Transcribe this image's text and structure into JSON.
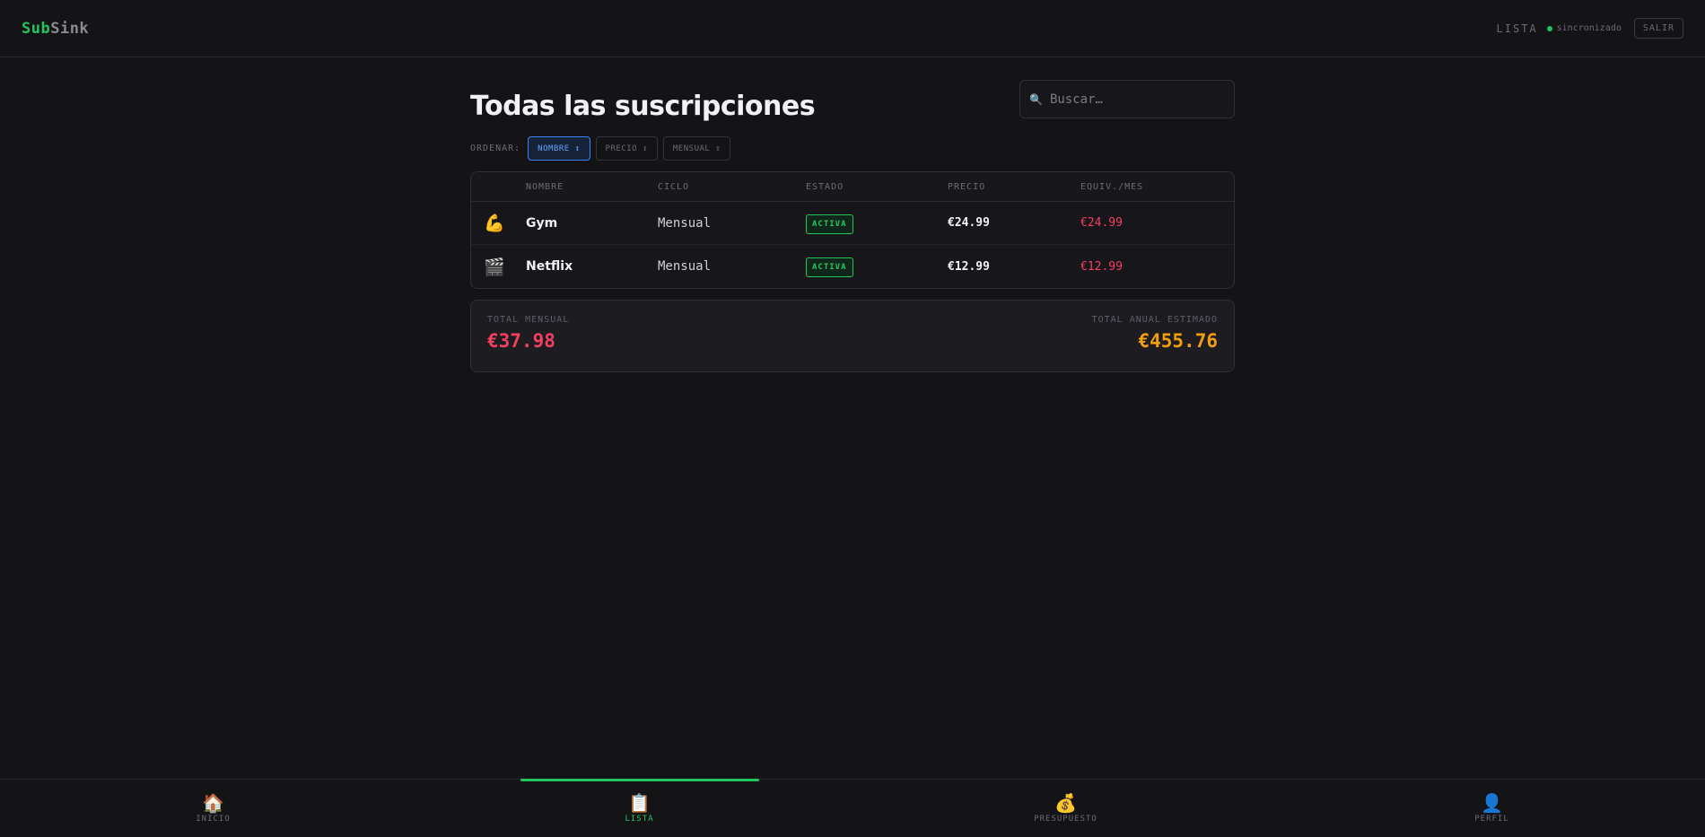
{
  "app": {
    "logo_part1": "Sub",
    "logo_part2": "Sink"
  },
  "header": {
    "view_label": "LISTA",
    "sync_status": "sincronizado",
    "logout_label": "SALIR"
  },
  "page": {
    "title": "Todas las suscripciones"
  },
  "search": {
    "placeholder": "Buscar…"
  },
  "sort": {
    "label": "ORDENAR:",
    "options": [
      {
        "label": "NOMBRE ↕",
        "active": true
      },
      {
        "label": "PRECIO ↕",
        "active": false
      },
      {
        "label": "MENSUAL ↕",
        "active": false
      }
    ]
  },
  "table": {
    "headers": [
      "NOMBRE",
      "CICLO",
      "ESTADO",
      "PRECIO",
      "EQUIV./MES"
    ],
    "rows": [
      {
        "icon": "💪",
        "icon_name": "flexed-biceps-icon",
        "name": "Gym",
        "cycle": "Mensual",
        "status": "ACTIVA",
        "price": "€24.99",
        "monthly": "€24.99"
      },
      {
        "icon": "🎬",
        "icon_name": "clapperboard-icon",
        "name": "Netflix",
        "cycle": "Mensual",
        "status": "ACTIVA",
        "price": "€12.99",
        "monthly": "€12.99"
      }
    ]
  },
  "totals": {
    "monthly_label": "TOTAL MENSUAL",
    "monthly_value": "€37.98",
    "yearly_label": "TOTAL ANUAL ESTIMADO",
    "yearly_value": "€455.76"
  },
  "bottom_nav": {
    "items": [
      {
        "icon": "🏠",
        "icon_name": "home-icon",
        "label": "INICIO",
        "active": false
      },
      {
        "icon": "📋",
        "icon_name": "clipboard-icon",
        "label": "LISTA",
        "active": true
      },
      {
        "icon": "💰",
        "icon_name": "money-bag-icon",
        "label": "PRESUPUESTO",
        "active": false
      },
      {
        "icon": "👤",
        "icon_name": "user-icon",
        "label": "PERFIL",
        "active": false
      }
    ]
  },
  "colors": {
    "accent_green": "#22c55e",
    "accent_blue": "#3b82f6",
    "price_red": "#f43f5e",
    "annual_amber": "#f59e0b",
    "background": "#141417"
  }
}
